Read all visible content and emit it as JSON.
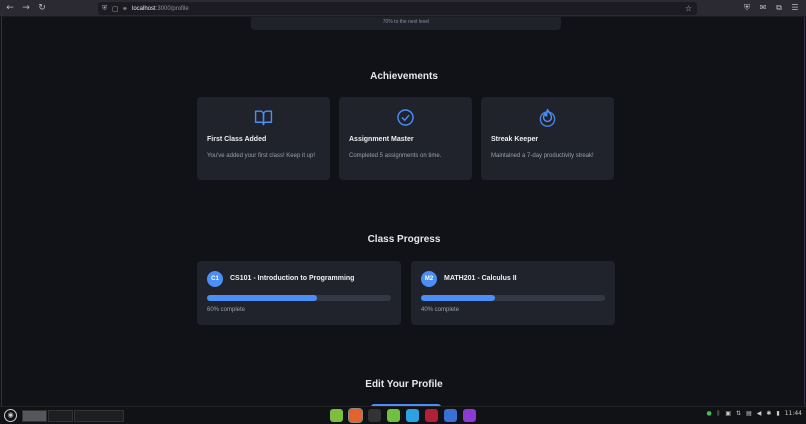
{
  "browser": {
    "nav": [
      "←",
      "→",
      "↻"
    ],
    "url_host": "localhost",
    "url_path": ":3000/profile",
    "star": "☆",
    "right_icons": [
      "⛨",
      "✉",
      "⧉",
      "☰"
    ]
  },
  "level": {
    "text": "70% to the next level"
  },
  "achievements": {
    "title": "Achievements",
    "items": [
      {
        "icon": "book-icon",
        "title": "First Class Added",
        "desc": "You've added your first class! Keep it up!"
      },
      {
        "icon": "check-circle-icon",
        "title": "Assignment Master",
        "desc": "Completed 5 assignments on time."
      },
      {
        "icon": "flame-icon",
        "title": "Streak Keeper",
        "desc": "Maintained a 7-day productivity streak!"
      }
    ]
  },
  "class_progress": {
    "title": "Class Progress",
    "items": [
      {
        "badge": "C1",
        "name": "CS101 - Introduction to Programming",
        "progress": 0.6,
        "label": "60% complete"
      },
      {
        "badge": "M2",
        "name": "MATH201 - Calculus II",
        "progress": 0.4,
        "label": "40% complete"
      }
    ]
  },
  "edit_profile": {
    "title": "Edit Your Profile"
  },
  "taskbar": {
    "clock": "11:44",
    "apps": [
      "files-icon",
      "firefox-icon",
      "terminal-icon",
      "editor-icon",
      "telegram-icon",
      "app-red-icon",
      "app-blue-icon",
      "app-purple-icon"
    ],
    "app_colors": [
      "#7cbf3e",
      "#e5632a",
      "#333333",
      "#6fbf40",
      "#2aa3e0",
      "#b0203a",
      "#3a6fd6",
      "#8c3ad6"
    ],
    "accent": "#4b8ef6"
  }
}
